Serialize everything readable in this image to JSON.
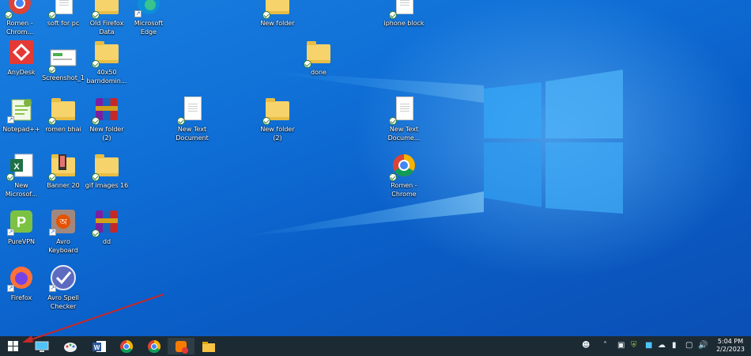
{
  "desktop": {
    "icons": [
      {
        "id": "romen-chrome-top",
        "label": "Romen -\nChrom..."
      },
      {
        "id": "soft-for-pc",
        "label": "soft for pc"
      },
      {
        "id": "old-firefox-data",
        "label": "Old Firefox\nData"
      },
      {
        "id": "microsoft-edge",
        "label": "Microsoft\nEdge"
      },
      {
        "id": "new-folder-top",
        "label": "New folder"
      },
      {
        "id": "iphone-block",
        "label": "iphone block"
      },
      {
        "id": "anydesk",
        "label": "AnyDesk"
      },
      {
        "id": "screenshot-1",
        "label": "Screenshot_1"
      },
      {
        "id": "40x50",
        "label": "40x50\nbarndomin..."
      },
      {
        "id": "done",
        "label": "done"
      },
      {
        "id": "notepadpp",
        "label": "Notepad++"
      },
      {
        "id": "romen-bhai",
        "label": "romen bhai"
      },
      {
        "id": "new-folder-2a",
        "label": "New folder\n(2)"
      },
      {
        "id": "new-text-doc-a",
        "label": "New Text\nDocument"
      },
      {
        "id": "new-folder-2b",
        "label": "New folder\n(2)"
      },
      {
        "id": "new-text-doc-b",
        "label": "New Text\nDocume..."
      },
      {
        "id": "new-microsoft",
        "label": "New\nMicrosof..."
      },
      {
        "id": "banner-20",
        "label": "Banner 20"
      },
      {
        "id": "gif-images-16",
        "label": "gif images 16"
      },
      {
        "id": "romen-chrome",
        "label": "Romen -\nChrome"
      },
      {
        "id": "purevpn",
        "label": "PureVPN"
      },
      {
        "id": "avro-keyboard",
        "label": "Avro\nKeyboard"
      },
      {
        "id": "dd",
        "label": "dd"
      },
      {
        "id": "firefox",
        "label": "Firefox"
      },
      {
        "id": "avro-spell-checker",
        "label": "Avro Spell\nChecker"
      }
    ]
  },
  "taskbar": {
    "apps": [
      {
        "name": "start",
        "icon": "windows-logo-icon"
      },
      {
        "name": "this-pc",
        "icon": "computer-icon"
      },
      {
        "name": "paint",
        "icon": "paint-icon"
      },
      {
        "name": "word",
        "icon": "word-icon"
      },
      {
        "name": "chrome-1",
        "icon": "chrome-icon"
      },
      {
        "name": "chrome-2",
        "icon": "chrome-icon"
      },
      {
        "name": "skype",
        "icon": "skype-icon"
      },
      {
        "name": "file-explorer",
        "icon": "folder-icon"
      }
    ],
    "tray": {
      "clock_time": "5:04 PM",
      "clock_date": "2/2/2023"
    }
  },
  "colors": {
    "taskbar": "#1c2a33",
    "arrow": "#c62828",
    "desktop": "#0f6fd6"
  }
}
